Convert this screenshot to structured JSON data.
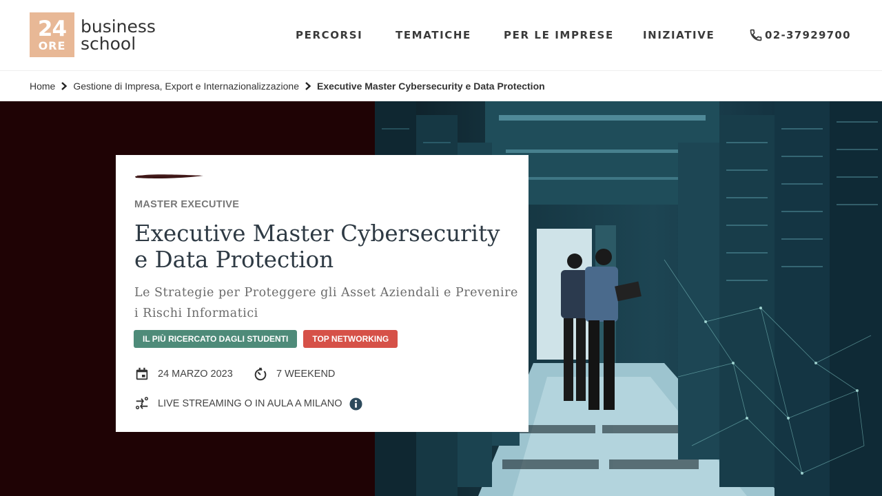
{
  "header": {
    "logo": {
      "number": "24",
      "ore": "ORE",
      "line1": "business",
      "line2": "school",
      "accent_color": "#e8b896"
    },
    "nav": [
      {
        "label": "PERCORSI"
      },
      {
        "label": "TEMATICHE"
      },
      {
        "label": "PER LE IMPRESE"
      },
      {
        "label": "INIZIATIVE"
      }
    ],
    "phone": {
      "icon": "phone-icon",
      "number": "02-37929700"
    }
  },
  "breadcrumb": {
    "items": [
      {
        "label": "Home"
      },
      {
        "label": "Gestione di Impresa, Export e Internazionalizzazione"
      },
      {
        "label": "Executive Master Cybersecurity e Data Protection"
      }
    ],
    "separator_icon": "chevron-right-icon"
  },
  "hero": {
    "background_color": "#1f0305",
    "photo": "server-room-photo",
    "card": {
      "eyebrow": "MASTER EXECUTIVE",
      "title_line1": "Executive Master Cybersecurity",
      "title_line2": "e Data Protection",
      "subtitle_line1": "Le Strategie per Proteggere gli Asset Aziendali e Prevenire",
      "subtitle_line2": "i Rischi Informatici",
      "badges": [
        {
          "label": "IL PIÙ RICERCATO DAGLI STUDENTI",
          "color": "#4e8b79"
        },
        {
          "label": "TOP NETWORKING",
          "color": "#d65148"
        }
      ],
      "date": {
        "icon": "calendar-icon",
        "text": "24 MARZO 2023"
      },
      "duration": {
        "icon": "timer-icon",
        "text": "7 WEEKEND"
      },
      "mode": {
        "icon": "swap-icon",
        "text": "LIVE STREAMING O IN AULA A MILANO",
        "info_icon": "info-icon"
      }
    }
  }
}
